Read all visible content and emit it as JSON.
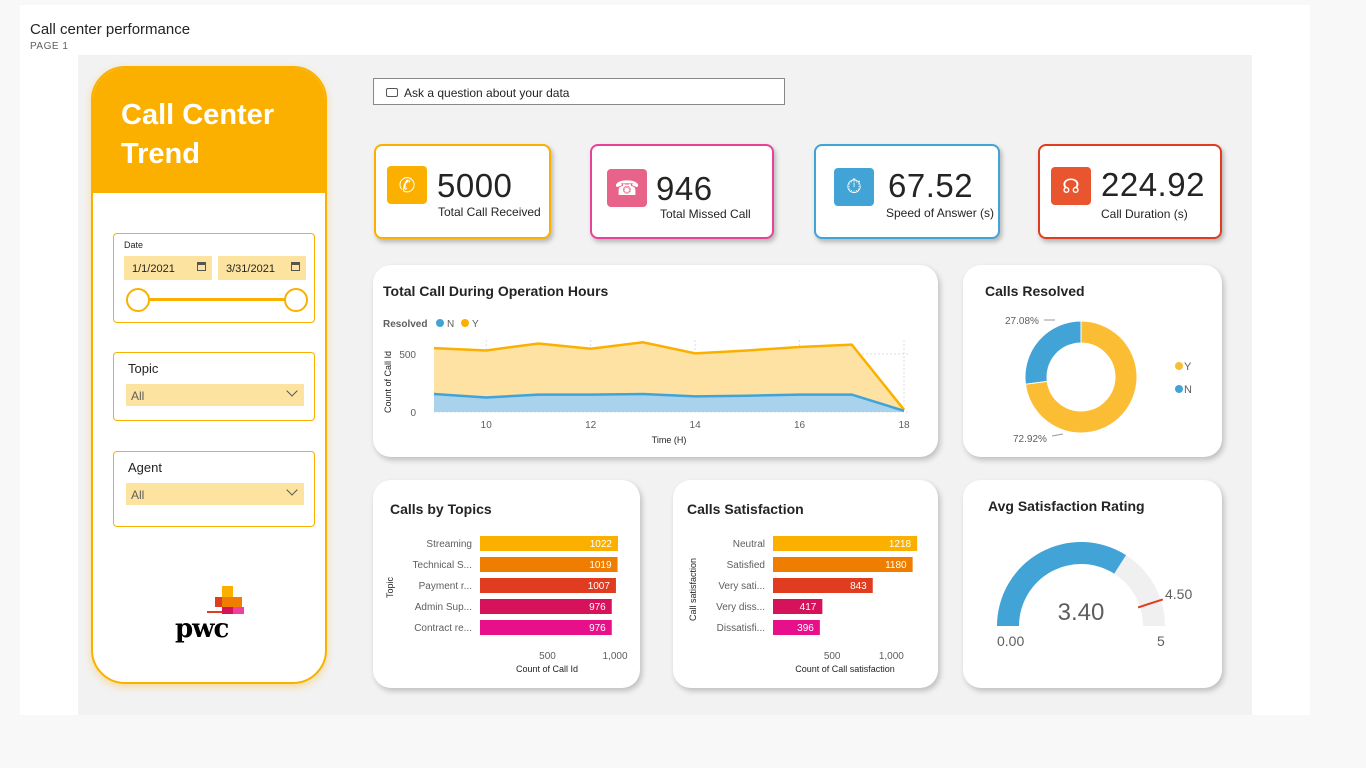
{
  "report": {
    "title": "Call center performance",
    "page": "PAGE 1"
  },
  "sidebar": {
    "title": "Call Center Trend",
    "date": {
      "label": "Date",
      "start": "1/1/2021",
      "end": "3/31/2021"
    },
    "topic": {
      "label": "Topic",
      "value": "All"
    },
    "agent": {
      "label": "Agent",
      "value": "All"
    },
    "logo": "pwc"
  },
  "qna": {
    "placeholder": "Ask a question about your data"
  },
  "kpis": [
    {
      "value": "5000",
      "label": "Total Call Received",
      "color": "#fbb000",
      "icon": "phone-icon"
    },
    {
      "value": "946",
      "label": "Total Missed Call",
      "color": "#e8419b",
      "icon": "missed-call-icon"
    },
    {
      "value": "67.52",
      "label": "Speed of Answer (s)",
      "color": "#41a3d6",
      "icon": "speed-icon"
    },
    {
      "value": "224.92",
      "label": "Call Duration (s)",
      "color": "#e03c1f",
      "icon": "headset-icon"
    }
  ],
  "operation_chart": {
    "title": "Total Call During Operation Hours",
    "legend_title": "Resolved",
    "legend": [
      "N",
      "Y"
    ],
    "ylabel": "Count of Call Id",
    "xlabel": "Time (H)",
    "y_ticks": [
      "0",
      "500"
    ],
    "x_ticks": [
      "10",
      "12",
      "14",
      "16",
      "18"
    ]
  },
  "resolved_chart": {
    "title": "Calls Resolved",
    "label_n": "27.08%",
    "label_y": "72.92%",
    "legend": [
      "Y",
      "N"
    ]
  },
  "topics_chart": {
    "title": "Calls by Topics",
    "ylabel": "Topic",
    "xlabel": "Count of Call Id",
    "x_ticks": [
      "500",
      "1,000"
    ]
  },
  "satisfaction_chart": {
    "title": "Calls Satisfaction",
    "ylabel": "Call satisfaction",
    "xlabel": "Count of Call satisfaction",
    "x_ticks": [
      "500",
      "1,000"
    ]
  },
  "gauge": {
    "title": "Avg Satisfaction Rating",
    "value": "3.40",
    "min": "0.00",
    "max": "5",
    "target": "4.50",
    "value_num": 3.4,
    "max_num": 5,
    "target_num": 4.5
  },
  "chart_data": [
    {
      "type": "area",
      "title": "Total Call During Operation Hours",
      "xlabel": "Time (H)",
      "ylabel": "Count of Call Id",
      "x": [
        9,
        10,
        11,
        12,
        13,
        14,
        15,
        16,
        17,
        18
      ],
      "series": [
        {
          "name": "N",
          "color": "#41a3d6",
          "values": [
            155,
            125,
            150,
            150,
            155,
            135,
            140,
            150,
            150,
            10
          ]
        },
        {
          "name": "Y",
          "color": "#fbb000",
          "values": [
            550,
            530,
            590,
            545,
            600,
            505,
            530,
            560,
            580,
            20
          ]
        }
      ],
      "xlim": [
        9,
        18
      ],
      "ylim": [
        0,
        620
      ],
      "grid": true,
      "legend": "top-left"
    },
    {
      "type": "pie",
      "title": "Calls Resolved",
      "categories": [
        "Y",
        "N"
      ],
      "values": [
        72.92,
        27.08
      ],
      "colors": [
        "#fbbd33",
        "#41a3d6"
      ],
      "legend": "right"
    },
    {
      "type": "bar",
      "title": "Calls by Topics",
      "categories": [
        "Streaming",
        "Technical S...",
        "Payment r...",
        "Admin Sup...",
        "Contract re..."
      ],
      "values": [
        1022,
        1019,
        1007,
        976,
        976
      ],
      "colors": [
        "#fbb000",
        "#ef7d00",
        "#e03c1f",
        "#d6125a",
        "#e8108a"
      ],
      "xlim": [
        0,
        1200
      ],
      "xlabel": "Count of Call Id",
      "ylabel": "Topic"
    },
    {
      "type": "bar",
      "title": "Calls Satisfaction",
      "categories": [
        "Neutral",
        "Satisfied",
        "Very sati...",
        "Very diss...",
        "Dissatisfi..."
      ],
      "values": [
        1218,
        1180,
        843,
        417,
        396
      ],
      "colors": [
        "#fbb000",
        "#ef7d00",
        "#e03c1f",
        "#d6125a",
        "#e8108a"
      ],
      "xlim": [
        0,
        1200
      ],
      "xlabel": "Count of Call satisfaction",
      "ylabel": "Call satisfaction"
    }
  ]
}
